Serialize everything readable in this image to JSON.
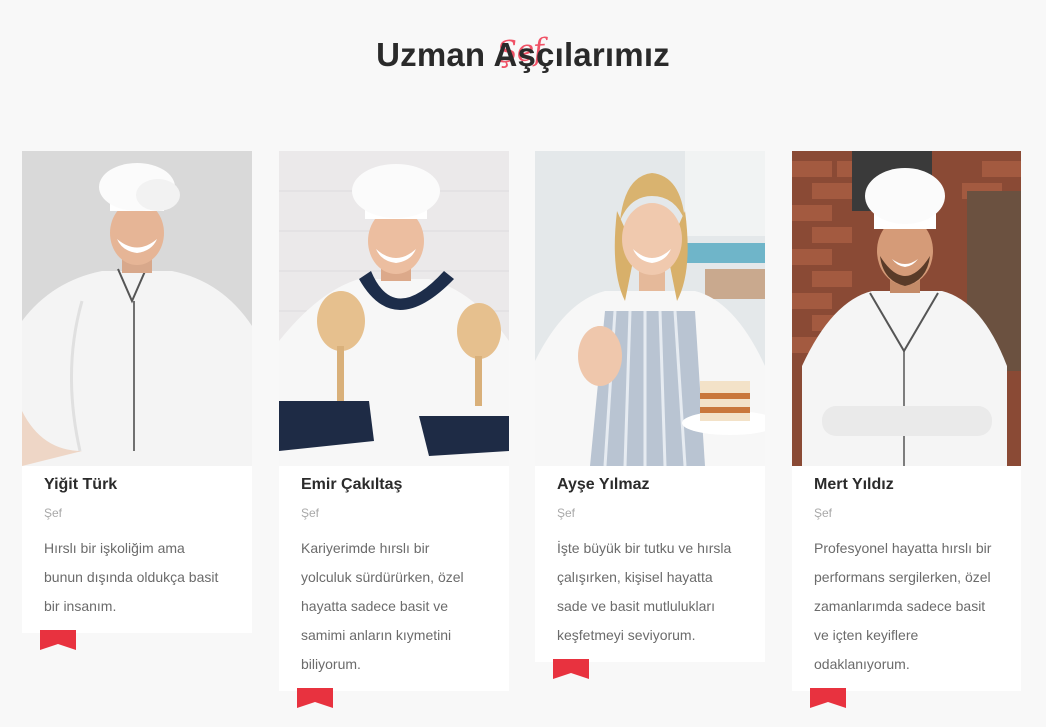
{
  "heading": {
    "script": "Şef",
    "title": "Uzman Aşçılarımız"
  },
  "colors": {
    "accent": "#e8323f",
    "script": "#f05266",
    "title": "#2a2a2a",
    "page_bg": "#f8f8f8"
  },
  "chefs": [
    {
      "name": "Yiğit Türk",
      "role": "Şef",
      "bio": [
        "Hırslı bir işkoliğim ama",
        "bunun dışında oldukça basit",
        "bir insanım."
      ]
    },
    {
      "name": "Emir Çakıltaş",
      "role": "Şef",
      "bio": [
        "Kariyerimde hırslı bir",
        "yolculuk sürdürürken, özel",
        "hayatta sadece basit ve",
        "samimi anların kıymetini",
        "biliyorum."
      ]
    },
    {
      "name": "Ayşe Yılmaz",
      "role": "Şef",
      "bio": [
        "İşte büyük bir tutku ve hırsla",
        "çalışırken, kişisel hayatta",
        "sade ve basit mutlulukları",
        "keşfetmeyi seviyorum."
      ]
    },
    {
      "name": "Mert Yıldız",
      "role": "Şef",
      "bio": [
        "Profesyonel hayatta hırslı bir",
        "performans sergilerken, özel",
        "zamanlarımda sadece basit",
        "ve içten keyiflere",
        "odaklanıyorum."
      ]
    }
  ]
}
